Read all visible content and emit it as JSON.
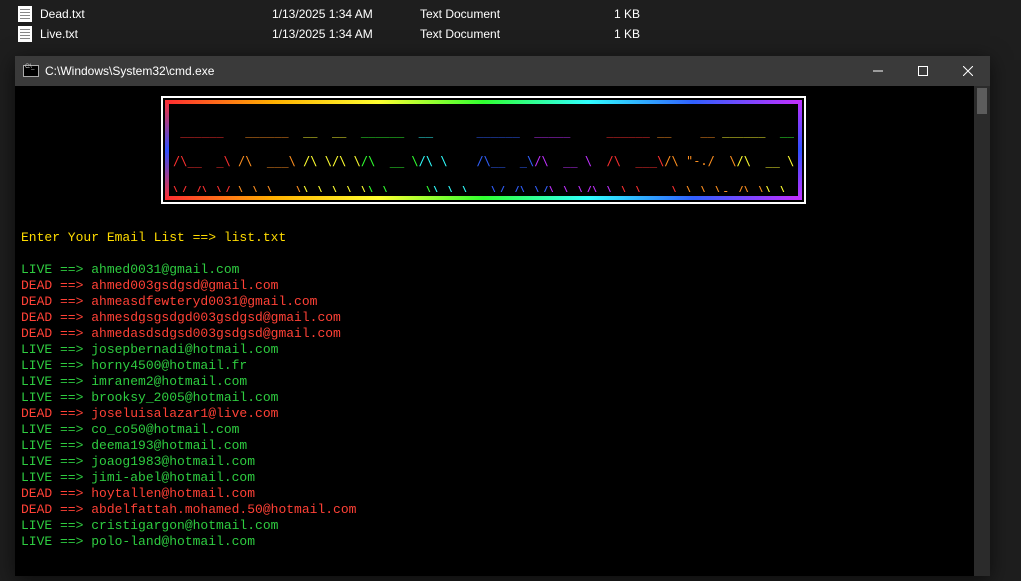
{
  "explorer": {
    "files": [
      {
        "name": "Dead.txt",
        "date": "1/13/2025 1:34 AM",
        "type": "Text Document",
        "size": "1 KB"
      },
      {
        "name": "Live.txt",
        "date": "1/13/2025 1:34 AM",
        "type": "Text Document",
        "size": "1 KB"
      }
    ]
  },
  "console": {
    "title": "C:\\Windows\\System32\\cmd.exe",
    "banner_label": "IG VALID EMAIL",
    "prompt": "Enter Your Email List ==> list.txt",
    "results": [
      {
        "status": "LIVE",
        "email": "ahmed0031@gmail.com"
      },
      {
        "status": "DEAD",
        "email": "ahmed003gsdgsd@gmail.com"
      },
      {
        "status": "DEAD",
        "email": "ahmeasdfewteryd0031@gmail.com"
      },
      {
        "status": "DEAD",
        "email": "ahmesdgsgsdgd003gsdgsd@gmail.com"
      },
      {
        "status": "DEAD",
        "email": "ahmedasdsdgsd003gsdgsd@gmail.com"
      },
      {
        "status": "LIVE",
        "email": "josepbernadi@hotmail.com"
      },
      {
        "status": "LIVE",
        "email": "horny4500@hotmail.fr"
      },
      {
        "status": "LIVE",
        "email": "imranem2@hotmail.com"
      },
      {
        "status": "LIVE",
        "email": "brooksy_2005@hotmail.com"
      },
      {
        "status": "DEAD",
        "email": "joseluisalazar1@live.com"
      },
      {
        "status": "LIVE",
        "email": "co_co50@hotmail.com"
      },
      {
        "status": "LIVE",
        "email": "deema193@hotmail.com"
      },
      {
        "status": "LIVE",
        "email": "joaog1983@hotmail.com"
      },
      {
        "status": "LIVE",
        "email": "jimi-abel@hotmail.com"
      },
      {
        "status": "DEAD",
        "email": "hoytallen@hotmail.com"
      },
      {
        "status": "DEAD",
        "email": "abdelfattah.mohamed.50@hotmail.com"
      },
      {
        "status": "LIVE",
        "email": "cristigargon@hotmail.com"
      },
      {
        "status": "LIVE",
        "email": "polo-land@hotmail.com"
      }
    ]
  }
}
